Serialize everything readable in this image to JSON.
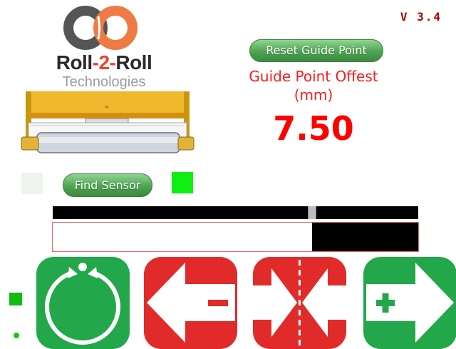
{
  "brand": {
    "name_pre": "Roll",
    "name_mid": "-2-",
    "name_post": "Roll",
    "subtitle": "Technologies",
    "logo_colors": {
      "left": "#555555",
      "right": "#ee7a44"
    }
  },
  "version": "V 3.4",
  "reset_button": {
    "label": "Reset Guide Point"
  },
  "offset": {
    "label_line1": "Guide Point Offest",
    "label_line2": "(mm)",
    "value": "7.50"
  },
  "find_sensor_button": {
    "label": "Find Sensor"
  },
  "sensors": {
    "left_color": "#eef3ee",
    "right_color": "#11ee11"
  },
  "position_bar": {
    "marker_fraction": 0.71
  },
  "edge_bar": {
    "fill_fraction": 0.29
  },
  "status": {
    "square_color": "#11bb11",
    "dot_color": "#11cc11"
  },
  "controls": [
    {
      "name": "auto-guide",
      "icon": "circular-arrows-icon",
      "color": "#22a84a"
    },
    {
      "name": "move-minus",
      "icon": "left-arrow-minus-icon",
      "color": "#e12b2b"
    },
    {
      "name": "center",
      "icon": "center-arrows-icon",
      "color": "#e12b2b"
    },
    {
      "name": "move-plus",
      "icon": "right-arrow-plus-icon",
      "color": "#22a84a"
    }
  ],
  "colors": {
    "accent_red": "#ff0000",
    "accent_green": "#22a84a",
    "button_green": "#4da451"
  }
}
